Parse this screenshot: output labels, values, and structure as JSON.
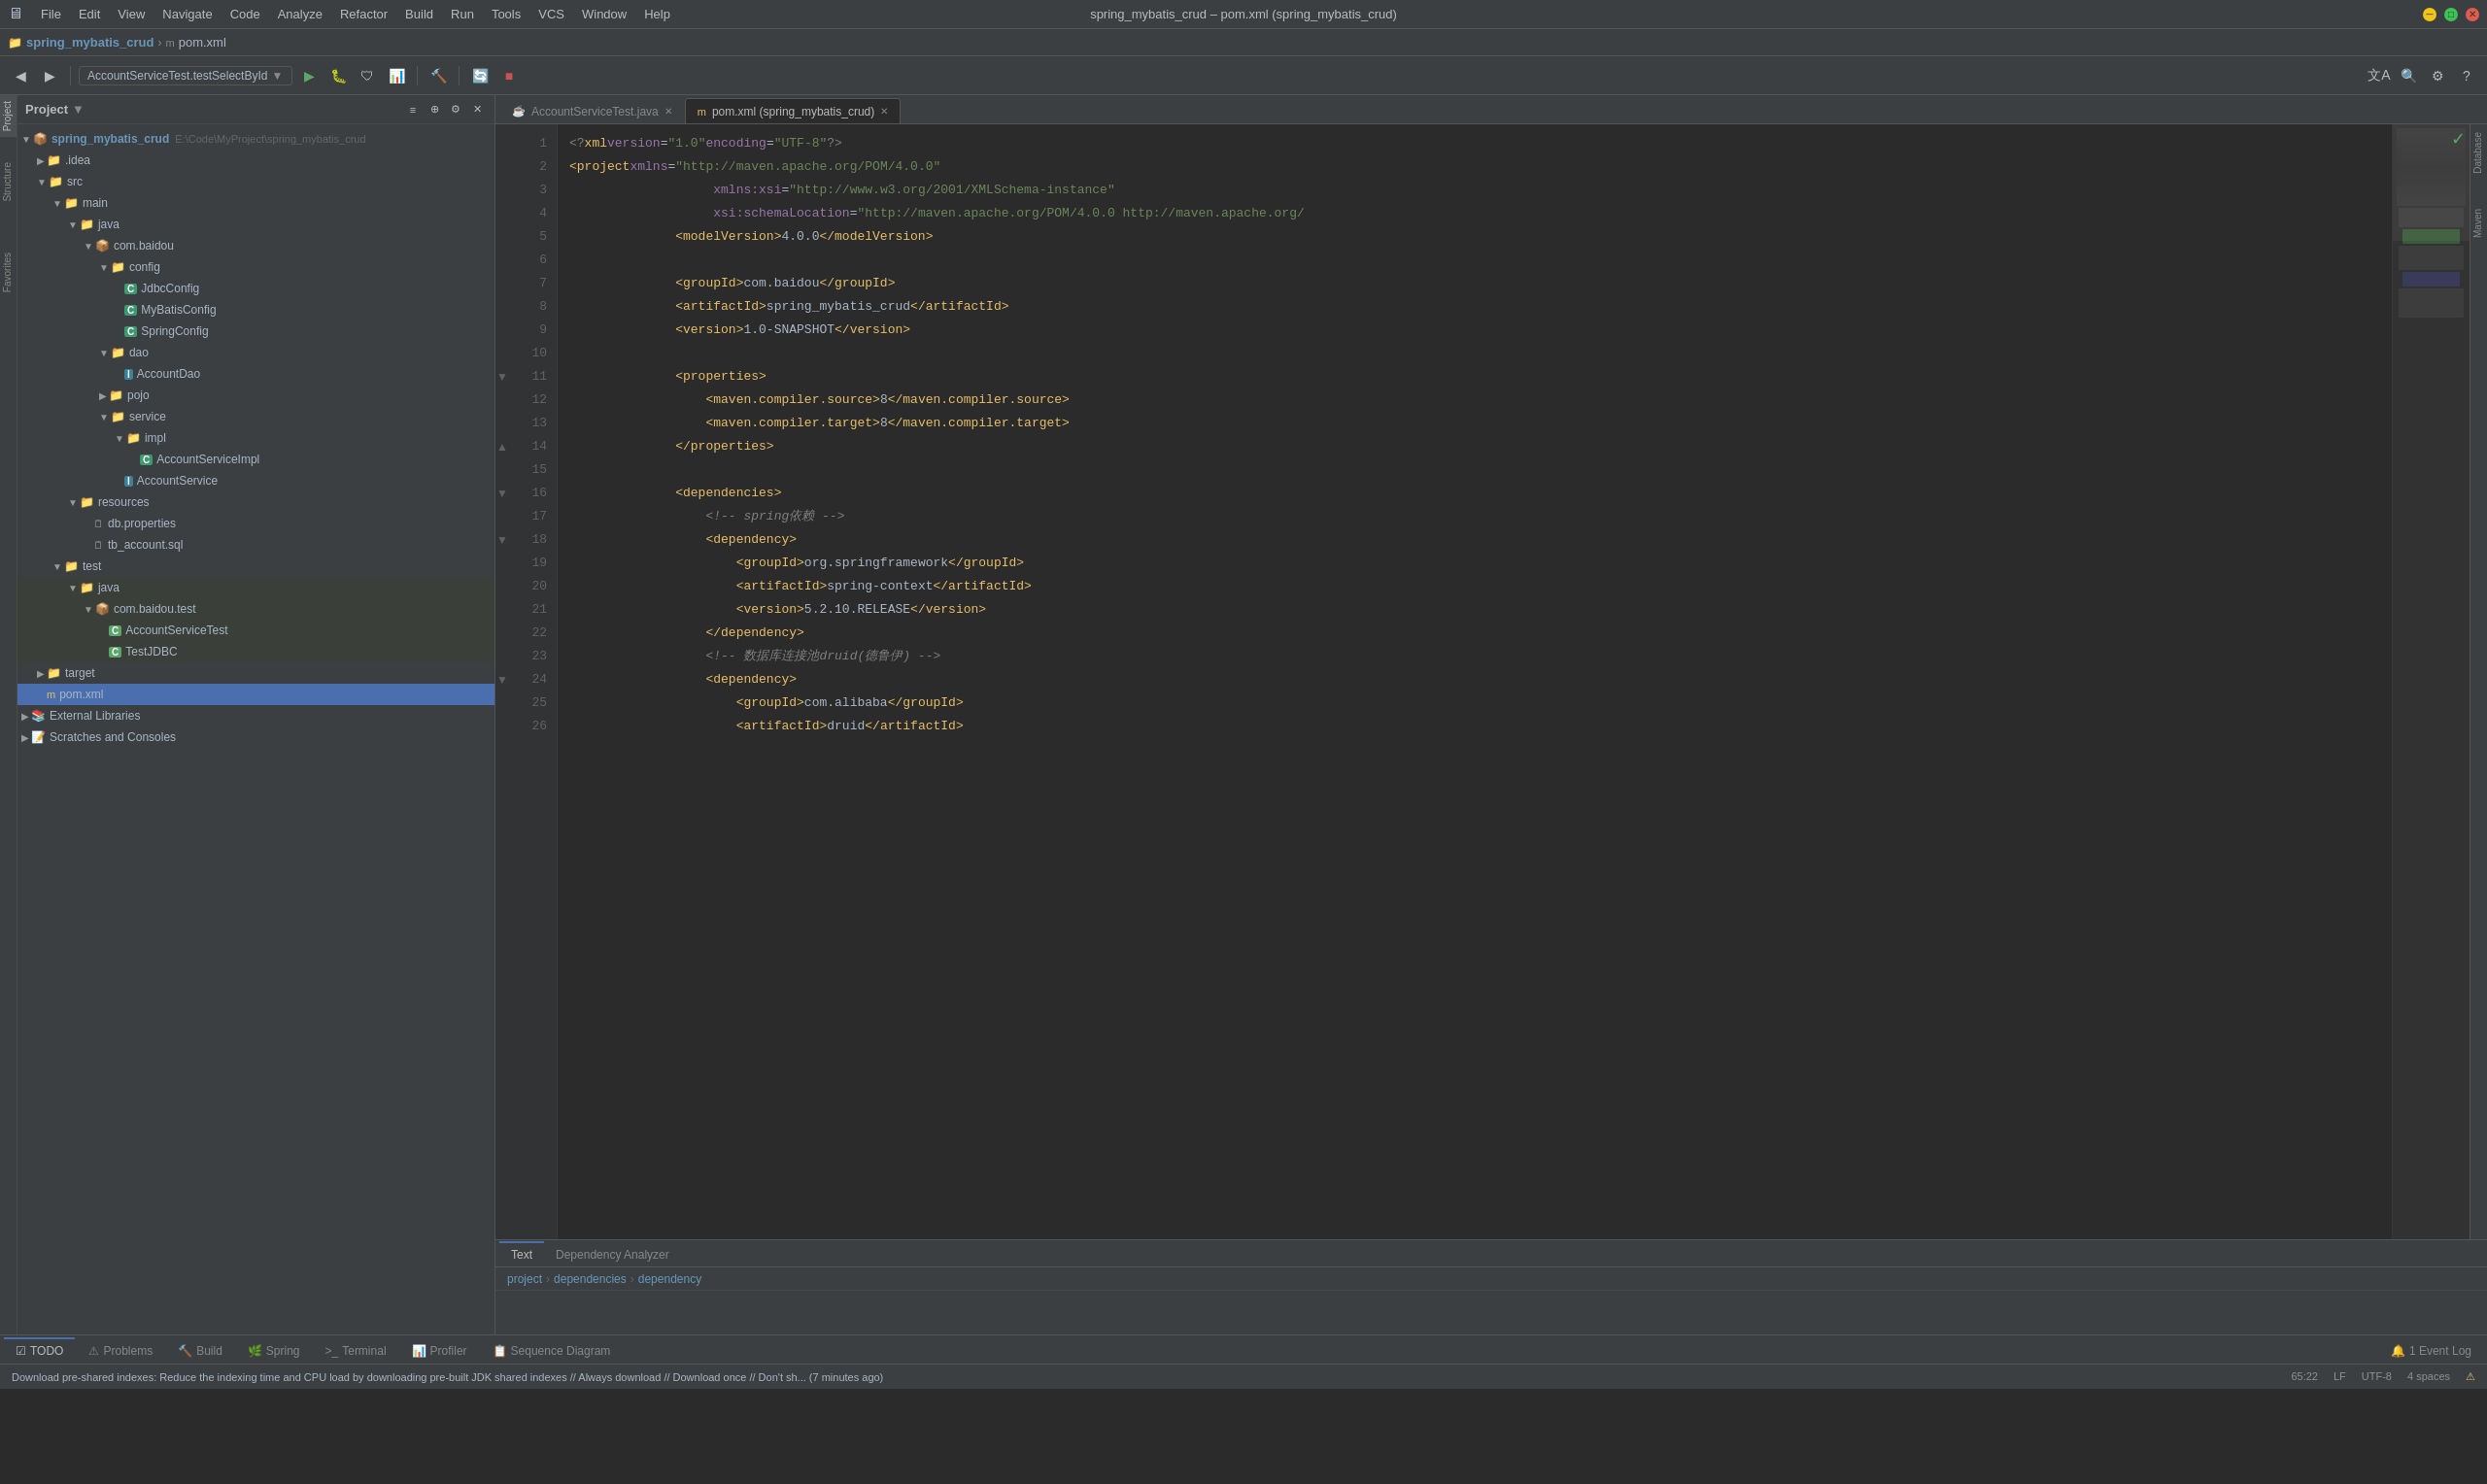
{
  "titlebar": {
    "menus": [
      "File",
      "Edit",
      "View",
      "Navigate",
      "Code",
      "Analyze",
      "Refactor",
      "Build",
      "Run",
      "Tools",
      "VCS",
      "Window",
      "Help"
    ],
    "title": "spring_mybatis_crud – pom.xml (spring_mybatis_crud)",
    "window_controls": [
      "minimize",
      "maximize",
      "close"
    ]
  },
  "breadcrumb": {
    "project_name": "spring_mybatis_crud",
    "separator": " › ",
    "file_name": "pom.xml"
  },
  "toolbar": {
    "run_config": "AccountServiceTest.testSelectById",
    "buttons": [
      "back",
      "forward",
      "run",
      "debug",
      "coverage",
      "profile",
      "stop",
      "build",
      "search",
      "settings"
    ]
  },
  "project_panel": {
    "title": "Project",
    "tree": [
      {
        "id": "spring_mybatis_crud",
        "level": 0,
        "label": "spring_mybatis_crud",
        "type": "module",
        "hint": "E:\\Code\\MyProject\\spring_mybatis_crud",
        "expanded": true,
        "bold": true,
        "color": "bold-blue"
      },
      {
        "id": "idea",
        "level": 1,
        "label": ".idea",
        "type": "folder",
        "expanded": false
      },
      {
        "id": "src",
        "level": 1,
        "label": "src",
        "type": "folder",
        "expanded": true
      },
      {
        "id": "main",
        "level": 2,
        "label": "main",
        "type": "folder",
        "expanded": true
      },
      {
        "id": "java",
        "level": 3,
        "label": "java",
        "type": "source-root",
        "expanded": true
      },
      {
        "id": "com.baidou",
        "level": 4,
        "label": "com.baidou",
        "type": "package",
        "expanded": true
      },
      {
        "id": "config",
        "level": 5,
        "label": "config",
        "type": "folder",
        "expanded": true
      },
      {
        "id": "JdbcConfig",
        "level": 6,
        "label": "JdbcConfig",
        "type": "java-class"
      },
      {
        "id": "MyBatisConfig",
        "level": 6,
        "label": "MyBatisConfig",
        "type": "java-class"
      },
      {
        "id": "SpringConfig",
        "level": 6,
        "label": "SpringConfig",
        "type": "java-class"
      },
      {
        "id": "dao",
        "level": 5,
        "label": "dao",
        "type": "folder",
        "expanded": true
      },
      {
        "id": "AccountDao",
        "level": 6,
        "label": "AccountDao",
        "type": "java-interface"
      },
      {
        "id": "pojo",
        "level": 5,
        "label": "pojo",
        "type": "folder",
        "expanded": false
      },
      {
        "id": "service",
        "level": 5,
        "label": "service",
        "type": "folder",
        "expanded": true
      },
      {
        "id": "impl",
        "level": 6,
        "label": "impl",
        "type": "folder",
        "expanded": true
      },
      {
        "id": "AccountServiceImpl",
        "level": 7,
        "label": "AccountServiceImpl",
        "type": "java-class"
      },
      {
        "id": "AccountService",
        "level": 6,
        "label": "AccountService",
        "type": "java-interface"
      },
      {
        "id": "resources",
        "level": 3,
        "label": "resources",
        "type": "resources-root",
        "expanded": true
      },
      {
        "id": "db.properties",
        "level": 4,
        "label": "db.properties",
        "type": "props-file"
      },
      {
        "id": "tb_account.sql",
        "level": 4,
        "label": "tb_account.sql",
        "type": "sql-file"
      },
      {
        "id": "test",
        "level": 2,
        "label": "test",
        "type": "folder",
        "expanded": true
      },
      {
        "id": "java_test",
        "level": 3,
        "label": "java",
        "type": "test-source-root",
        "expanded": true
      },
      {
        "id": "com.baidou.test",
        "level": 4,
        "label": "com.baidou.test",
        "type": "package",
        "expanded": true
      },
      {
        "id": "AccountServiceTest",
        "level": 5,
        "label": "AccountServiceTest",
        "type": "java-test"
      },
      {
        "id": "TestJDBC",
        "level": 5,
        "label": "TestJDBC",
        "type": "java-test"
      },
      {
        "id": "target",
        "level": 1,
        "label": "target",
        "type": "folder",
        "expanded": false
      },
      {
        "id": "pom.xml",
        "level": 1,
        "label": "pom.xml",
        "type": "xml-file",
        "selected": true
      },
      {
        "id": "External Libraries",
        "level": 0,
        "label": "External Libraries",
        "type": "external-lib",
        "expanded": false
      },
      {
        "id": "Scratches and Consoles",
        "level": 0,
        "label": "Scratches and Consoles",
        "type": "scratches",
        "expanded": false
      }
    ]
  },
  "editor": {
    "tabs": [
      {
        "label": "AccountServiceTest.java",
        "type": "java",
        "active": false,
        "icon": "☕"
      },
      {
        "label": "pom.xml (spring_mybatis_crud)",
        "type": "xml",
        "active": true,
        "icon": "📄"
      }
    ],
    "lines": [
      {
        "num": 1,
        "content": "<?xml version=\"1.0\" encoding=\"UTF-8\"?>",
        "type": "xml-decl"
      },
      {
        "num": 2,
        "content": "<project xmlns=\"http://maven.apache.org/POM/4.0.0\"",
        "type": "code"
      },
      {
        "num": 3,
        "content": "         xmlns:xsi=\"http://www.w3.org/2001/XMLSchema-instance\"",
        "type": "code"
      },
      {
        "num": 4,
        "content": "         xsi:schemaLocation=\"http://maven.apache.org/POM/4.0.0 http://maven.apache.org/",
        "type": "code"
      },
      {
        "num": 5,
        "content": "    <modelVersion>4.0.0</modelVersion>",
        "type": "code"
      },
      {
        "num": 6,
        "content": "",
        "type": "blank"
      },
      {
        "num": 7,
        "content": "    <groupId>com.baidou</groupId>",
        "type": "code"
      },
      {
        "num": 8,
        "content": "    <artifactId>spring_mybatis_crud</artifactId>",
        "type": "code"
      },
      {
        "num": 9,
        "content": "    <version>1.0-SNAPSHOT</version>",
        "type": "code"
      },
      {
        "num": 10,
        "content": "",
        "type": "blank"
      },
      {
        "num": 11,
        "content": "    <properties>",
        "type": "code",
        "fold": true
      },
      {
        "num": 12,
        "content": "        <maven.compiler.source>8</maven.compiler.source>",
        "type": "code"
      },
      {
        "num": 13,
        "content": "        <maven.compiler.target>8</maven.compiler.target>",
        "type": "code"
      },
      {
        "num": 14,
        "content": "    </properties>",
        "type": "code",
        "fold": true
      },
      {
        "num": 15,
        "content": "",
        "type": "blank"
      },
      {
        "num": 16,
        "content": "    <dependencies>",
        "type": "code",
        "fold": true
      },
      {
        "num": 17,
        "content": "        <!-- spring依赖 -->",
        "type": "comment"
      },
      {
        "num": 18,
        "content": "        <dependency>",
        "type": "code",
        "fold": true
      },
      {
        "num": 19,
        "content": "            <groupId>org.springframework</groupId>",
        "type": "code"
      },
      {
        "num": 20,
        "content": "            <artifactId>spring-context</artifactId>",
        "type": "code"
      },
      {
        "num": 21,
        "content": "            <version>5.2.10.RELEASE</version>",
        "type": "code"
      },
      {
        "num": 22,
        "content": "        </dependency>",
        "type": "code"
      },
      {
        "num": 23,
        "content": "        <!-- 数据库连接池druid(德鲁伊) -->",
        "type": "comment"
      },
      {
        "num": 24,
        "content": "        <dependency>",
        "type": "code",
        "fold": true
      },
      {
        "num": 25,
        "content": "            <groupId>com.alibaba</groupId>",
        "type": "code"
      },
      {
        "num": 26,
        "content": "            <artifactId>druid</artifactId>",
        "type": "code"
      }
    ]
  },
  "bottom_panel": {
    "tabs": [
      {
        "label": "TODO",
        "icon": "☑"
      },
      {
        "label": "Problems",
        "icon": "⚠"
      },
      {
        "label": "Build",
        "icon": "🔨"
      },
      {
        "label": "Spring",
        "icon": "🌿"
      },
      {
        "label": "Terminal",
        "icon": ">_"
      },
      {
        "label": "Profiler",
        "icon": "📊"
      },
      {
        "label": "Sequence Diagram",
        "icon": "📋"
      }
    ],
    "active_tab": "Text",
    "bottom_tabs_editor": [
      {
        "label": "Text",
        "active": true
      },
      {
        "label": "Dependency Analyzer",
        "active": false
      }
    ],
    "breadcrumb": [
      "project",
      "dependencies",
      "dependency"
    ]
  },
  "status_bar": {
    "left_items": [
      "TODO",
      "⚠ Problems",
      "🔨 Build",
      "Spring",
      "Terminal",
      "Profiler",
      "Sequence Diagram"
    ],
    "notification": "Download pre-shared indexes: Reduce the indexing time and CPU load by downloading pre-built JDK shared indexes // Always download // Download once // Don't sh... (7 minutes ago)",
    "right_items": [
      "65:22",
      "LF",
      "UTF-8",
      "4 spaces",
      "⚠",
      "Event Log"
    ],
    "event_log": "1 Event Log"
  },
  "side_panels": {
    "right_labels": [
      "Database",
      "Maven"
    ],
    "left_labels": [
      "Project",
      "Structure",
      "Favorites"
    ]
  }
}
